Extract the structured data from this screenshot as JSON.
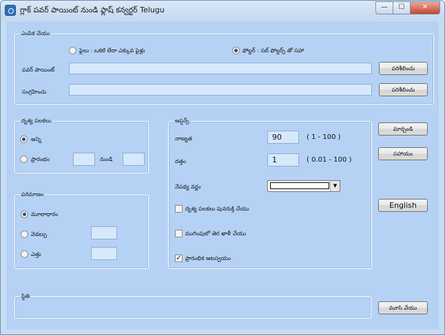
{
  "window": {
    "title": "గ్లాక్ పవర్ పాయింట్ నుండి ఫ్లాష్ కన్వర్టర్ Telugu",
    "min_glyph": "—",
    "max_glyph": "☐",
    "close_glyph": "✕"
  },
  "selection": {
    "legend": "ఎంపిక చేయు",
    "file_option": "ఫైలు :  ఒకటి లేదా ఎక్కువ ఫైళ్లు",
    "folder_option": "ఫోల్డర్ :  సబ్ ఫోల్డర్స్ తో సహా",
    "selected": "folder",
    "powerpoint_label": "పవర్ పాయింట్",
    "powerpoint_value": "",
    "output_label": "సంగ్రహించు",
    "output_value": "",
    "browse_label": "పరిశీలించు"
  },
  "slides": {
    "legend": "దృశ్య పలకలు",
    "all_label": "అన్ని",
    "from_label": "ప్రారంభం",
    "to_label": "నుండి",
    "from_value": "",
    "to_value": "",
    "selected": "all"
  },
  "size": {
    "legend": "పరిమాణం",
    "original_label": "మూలాధారం",
    "width_label": "వెడల్పు",
    "height_label": "ఎత్తు",
    "width_value": "",
    "height_value": "",
    "selected": "original"
  },
  "options": {
    "legend": "ఆప్షన్స్",
    "quality_label": "నాణ్యత",
    "quality_value": "90",
    "quality_range": "( 1 - 100 )",
    "scale_label": "దత్తం",
    "scale_value": "1",
    "scale_range": "( 0.01 - 100 )",
    "bg_color_label": "నేపథ్య వర్ణం",
    "bg_color": "#ffffff",
    "repeat_slides_label": "దృశ్య పలకలు పునరుక్తి చేయు",
    "repeat_slides_checked": false,
    "blank_end_label": "ముగింపులో తెర ఖాళీ చేయు",
    "blank_end_checked": false,
    "autoplay_label": "ప్రారంభిక ఆటస్వయం",
    "autoplay_checked": true
  },
  "buttons": {
    "convert": "మార్చండి",
    "help": "సహాయం",
    "english": "English",
    "close": "మూసి వేయు"
  },
  "status": {
    "legend": "స్థితి",
    "text": ""
  }
}
